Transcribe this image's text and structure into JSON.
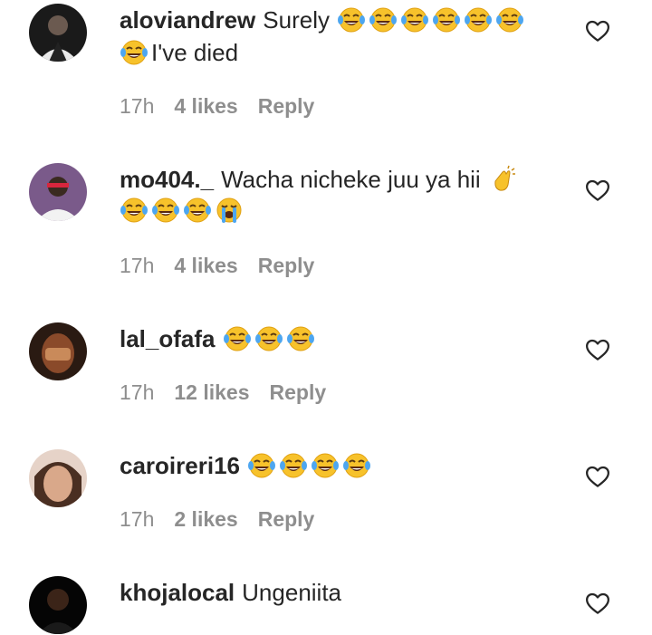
{
  "comments": [
    {
      "username": "aloviandrew",
      "text": "Surely",
      "line1_emojis": [
        "laughing-tears",
        "laughing-tears",
        "laughing-tears",
        "laughing-tears",
        "laughing-tears",
        "laughing-tears"
      ],
      "line2_emojis": [
        "laughing-tears"
      ],
      "line2_text": "I've died",
      "time": "17h",
      "likes": "4 likes",
      "reply": "Reply"
    },
    {
      "username": "mo404._",
      "text": "Wacha nicheke juu ya hii",
      "line1_emojis": [
        "clapping-hands"
      ],
      "line2_emojis": [
        "laughing-tears",
        "laughing-tears",
        "laughing-tears",
        "loudly-crying"
      ],
      "time": "17h",
      "likes": "4 likes",
      "reply": "Reply"
    },
    {
      "username": "lal_ofafa",
      "text": "",
      "line1_emojis": [
        "laughing-tears",
        "laughing-tears",
        "laughing-tears"
      ],
      "time": "17h",
      "likes": "12 likes",
      "reply": "Reply"
    },
    {
      "username": "caroireri16",
      "text": "",
      "line1_emojis": [
        "laughing-tears",
        "laughing-tears",
        "laughing-tears",
        "laughing-tears"
      ],
      "time": "17h",
      "likes": "2 likes",
      "reply": "Reply"
    },
    {
      "username": "khojalocal",
      "text": "Ungeniita",
      "line1_emojis": []
    }
  ],
  "icons": {
    "like": "heart-outline-icon"
  },
  "colors": {
    "text": "#262626",
    "meta": "#8e8e8e",
    "emoji_face": "#f7c22b",
    "tears": "#4da6f0"
  }
}
